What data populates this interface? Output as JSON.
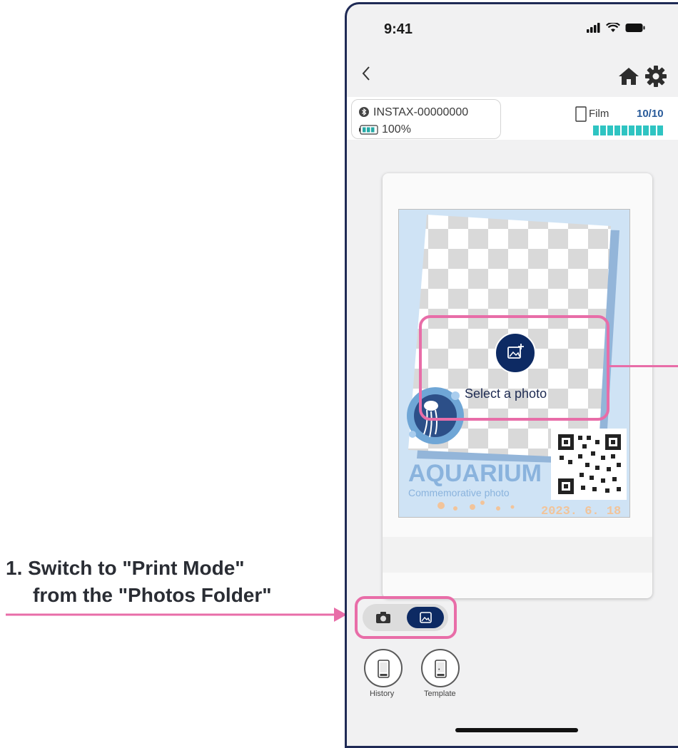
{
  "annotation": {
    "line1": "1. Switch to \"Print Mode\"",
    "line2": "from the \"Photos Folder\"",
    "color": "#e86da8"
  },
  "status_bar": {
    "time": "9:41",
    "icons": [
      "signal-icon",
      "wifi-icon",
      "battery-icon"
    ]
  },
  "nav": {
    "back_icon": "chevron-left-icon",
    "home_icon": "home-icon",
    "settings_icon": "gear-icon"
  },
  "device": {
    "name": "INSTAX-00000000",
    "battery": "100%"
  },
  "film": {
    "label": "Film",
    "count": "10/10",
    "remaining": 10,
    "total": 10,
    "color": "#2fc4c2"
  },
  "template": {
    "title": "AQUARIUM",
    "subtitle": "Commemorative photo",
    "date": "2023. 6. 18"
  },
  "select_photo": {
    "label": "Select a photo",
    "icon": "add-photo-icon"
  },
  "mode_toggle": {
    "camera_icon": "camera-icon",
    "photos_icon": "image-icon",
    "active": "photos"
  },
  "bottom_buttons": [
    {
      "label": "History",
      "icon": "phone-icon"
    },
    {
      "label": "Template",
      "icon": "phone-template-icon"
    }
  ],
  "colors": {
    "highlight": "#e86da8",
    "navy": "#0d2a63",
    "template_blue": "#cfe3f5"
  }
}
